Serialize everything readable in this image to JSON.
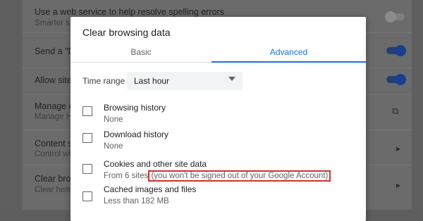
{
  "background": {
    "rows": [
      {
        "title": "Use a web service to help resolve spelling errors",
        "sub": "Smarter spelling",
        "control": "toggle-off"
      },
      {
        "title": "Send a \"Do Not Track\"",
        "sub": "",
        "control": "toggle-on"
      },
      {
        "title": "Allow sites",
        "sub": "",
        "control": "toggle-on"
      },
      {
        "title": "Manage certificates",
        "sub": "Manage HTTPS",
        "control": "external-link-icon"
      },
      {
        "title": "Content settings",
        "sub": "Control what",
        "control": "chevron-right-icon"
      },
      {
        "title": "Clear browsing data",
        "sub": "Clear history",
        "control": "chevron-right-icon"
      }
    ]
  },
  "dialog": {
    "title": "Clear browsing data",
    "tabs": [
      {
        "label": "Basic"
      },
      {
        "label": "Advanced"
      }
    ],
    "active_tab": "Advanced",
    "time_range": {
      "label": "Time range",
      "value": "Last hour"
    },
    "items": [
      {
        "title": "Browsing history",
        "sub": "None",
        "checked": false
      },
      {
        "title": "Download history",
        "sub": "None",
        "checked": false
      },
      {
        "title": "Cookies and other site data",
        "sub": "From 6 sites",
        "note": "(you won't be signed out of your Google Account)",
        "checked": false
      },
      {
        "title": "Cached images and files",
        "sub": "Less than 182 MB",
        "checked": false
      }
    ]
  },
  "colors": {
    "accent": "#1a73e8",
    "highlight_box": "#d0312d"
  }
}
